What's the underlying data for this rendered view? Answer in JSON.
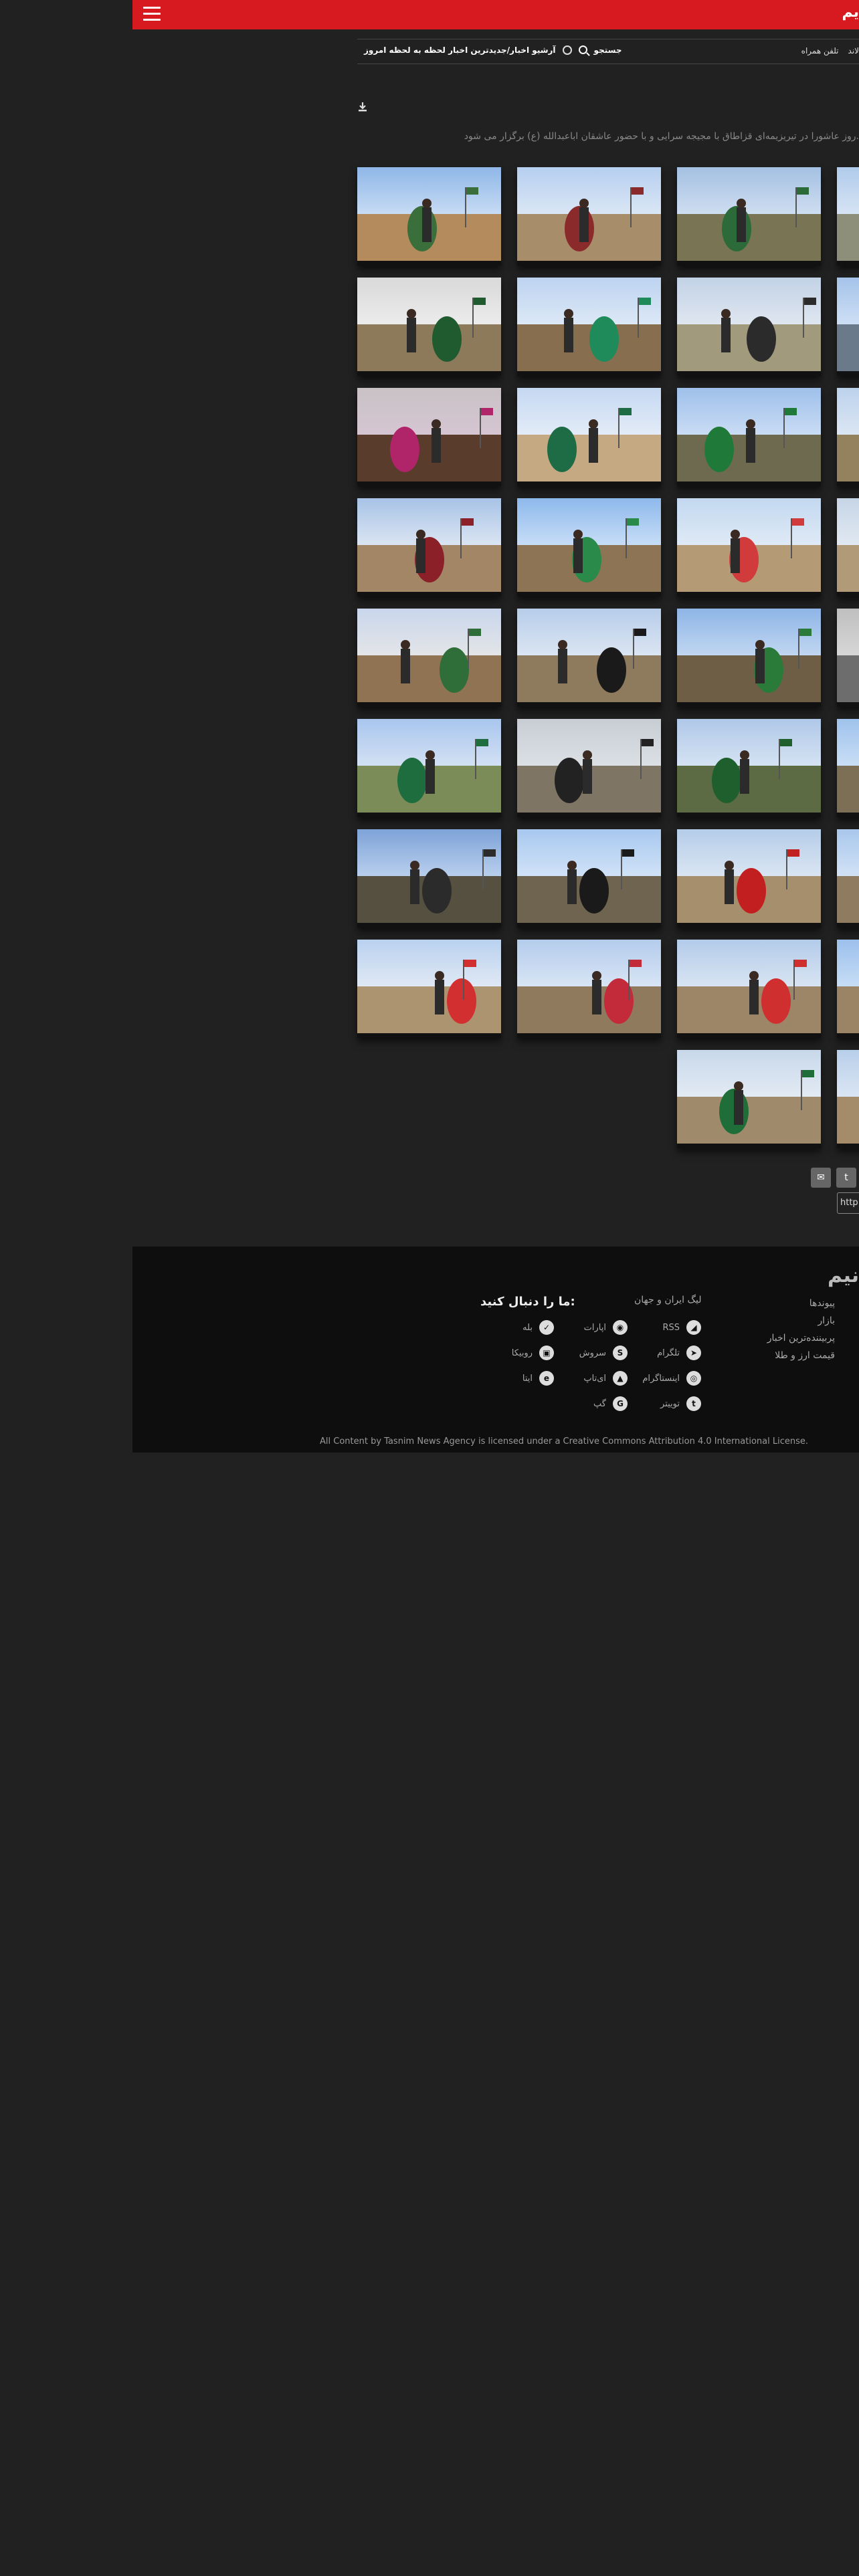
{
  "header": {
    "logo": "یم",
    "menu_icon": "hamburger-icon"
  },
  "subnav": {
    "latest": "آرشیو اخبار/جدیدترین اخبار لحظه به لحظه امروز",
    "search": "جستجو",
    "mobile": "تلفن همراه",
    "app": "لاند"
  },
  "lead": "روز عاشورا در تیریزیمه‌ای قزاطاق با مجیجه سرایی و با حضور عاشقان اباعبدالله (ع) برگزار می شود.",
  "gallery": {
    "photos": [
      {
        "palette": [
          "#8fb7e8",
          "#cfe0f5",
          "#b38b5c",
          "#3a6e3b"
        ]
      },
      {
        "palette": [
          "#d9d9d9",
          "#eeeeee",
          "#8c7a5a",
          "#1f5b2e"
        ]
      },
      {
        "palette": [
          "#c9c2c5",
          "#d7c6d4",
          "#5a3c2c",
          "#b0246a"
        ]
      },
      {
        "palette": [
          "#a7c3e6",
          "#e2e9f4",
          "#a38666",
          "#8b2028"
        ]
      },
      {
        "palette": [
          "#c9d6ec",
          "#e7e7e7",
          "#8f7353",
          "#2f6e39"
        ]
      },
      {
        "palette": [
          "#a9c6ee",
          "#d8e4f4",
          "#7b8c58",
          "#1e6d3f"
        ]
      },
      {
        "palette": [
          "#7ea3d8",
          "#c1d5f0",
          "#55503f",
          "#2b2b2b"
        ]
      },
      {
        "palette": [
          "#b9d1ef",
          "#e5ecf5",
          "#ac9471",
          "#d23030"
        ]
      },
      {
        "palette": [
          "#b6cff0",
          "#dfe9f5",
          "#a88d6a",
          "#8a2a2a"
        ]
      },
      {
        "palette": [
          "#bcd3f0",
          "#e1ebf7",
          "#866e4f",
          "#1f8a5a"
        ]
      },
      {
        "palette": [
          "#c5d8f2",
          "#e7eef8",
          "#c4a983",
          "#1e6c45"
        ]
      },
      {
        "palette": [
          "#8eb9ec",
          "#cfe2f8",
          "#8d7454",
          "#2a8a4a"
        ]
      },
      {
        "palette": [
          "#b7cdea",
          "#e0e8f3",
          "#8e7a5c",
          "#1a1a1a"
        ]
      },
      {
        "palette": [
          "#c7cdd3",
          "#dfe3e8",
          "#7e7564",
          "#222222"
        ]
      },
      {
        "palette": [
          "#a8c8ef",
          "#d6e6f8",
          "#6f6450",
          "#1a1a1a"
        ]
      },
      {
        "palette": [
          "#b4ccec",
          "#dde8f6",
          "#8f7a5d",
          "#c42b3a"
        ]
      },
      {
        "palette": [
          "#a4c0e2",
          "#d4e2f2",
          "#787454",
          "#2c6a3a"
        ]
      },
      {
        "palette": [
          "#c2d2e6",
          "#e3e9f1",
          "#a29a7d",
          "#2b2b2b"
        ]
      },
      {
        "palette": [
          "#9fc0ea",
          "#cfe0f6",
          "#6e6a50",
          "#1f7a3a"
        ]
      },
      {
        "palette": [
          "#c2d8f0",
          "#e3ecf6",
          "#b59a76",
          "#d23b3b"
        ]
      },
      {
        "palette": [
          "#8eb5e6",
          "#c8dbf3",
          "#6e5e46",
          "#2a7a3a"
        ]
      },
      {
        "palette": [
          "#afc8e8",
          "#dae6f4",
          "#5d6b45",
          "#1f5e2d"
        ]
      },
      {
        "palette": [
          "#b5cde9",
          "#dfe8f3",
          "#a68f6d",
          "#c22020"
        ]
      },
      {
        "palette": [
          "#b3cbe9",
          "#dde7f3",
          "#9d8667",
          "#d02f2f"
        ]
      },
      {
        "palette": [
          "#c8d8ea",
          "#e6edf5",
          "#9f8b6b",
          "#1f6e3a"
        ]
      },
      {
        "palette": [
          "#b0cbeb",
          "#dbe7f5",
          "#8d8f7a",
          "#3b3b3b"
        ]
      },
      {
        "palette": [
          "#a5c3e9",
          "#d3e3f6",
          "#6b7a8a",
          "#2a4a8a"
        ]
      },
      {
        "palette": [
          "#bcd2ec",
          "#e0e9f4",
          "#94825f",
          "#222222"
        ]
      },
      {
        "palette": [
          "#c6d5e6",
          "#e4ebf3",
          "#b09a78",
          "#2f7a4a"
        ]
      },
      {
        "palette": [
          "#bfbfbf",
          "#dadada",
          "#6d6d6d",
          "#2a5a3a"
        ]
      },
      {
        "palette": [
          "#9fc2ec",
          "#cfe2f7",
          "#7d6f55",
          "#1f5f35"
        ]
      },
      {
        "palette": [
          "#a9c7ec",
          "#d7e6f7",
          "#8f7c60",
          "#2c2c2c"
        ]
      },
      {
        "palette": [
          "#9cc0ec",
          "#cde1f7",
          "#9a8465",
          "#2b2b2b"
        ]
      },
      {
        "palette": [
          "#b8cfea",
          "#dfe8f4",
          "#a48b6a",
          "#c63a4a"
        ]
      }
    ]
  },
  "share": {
    "mail_icon": "mail-icon",
    "twitter_icon": "twitter-icon",
    "url_prefix": "http"
  },
  "footer": {
    "brand": "نیم",
    "links": [
      "پیوندها",
      "بازار",
      "پربیننده‌ترین اخبار",
      "قیمت ارز و طلا"
    ],
    "iran_world": "لیگ ایران و جهان",
    "follow_title": "ما را دنبال کنید:",
    "social": [
      {
        "label": "RSS",
        "glyph": "◢"
      },
      {
        "label": "تلگرام",
        "glyph": "➤"
      },
      {
        "label": "اینستاگرام",
        "glyph": "◎"
      },
      {
        "label": "توییتر",
        "glyph": "t"
      },
      {
        "label": "اپارات",
        "glyph": "◉"
      },
      {
        "label": "سروش",
        "glyph": "S"
      },
      {
        "label": "ای‌تاپ",
        "glyph": "▲"
      },
      {
        "label": "گپ",
        "glyph": "G"
      },
      {
        "label": "بله",
        "glyph": "✓"
      },
      {
        "label": "روبیکا",
        "glyph": "▣"
      },
      {
        "label": "ایتا",
        "glyph": "e"
      }
    ],
    "license": "All Content by Tasnim News Agency is licensed under a Creative Commons Attribution 4.0 International License."
  }
}
